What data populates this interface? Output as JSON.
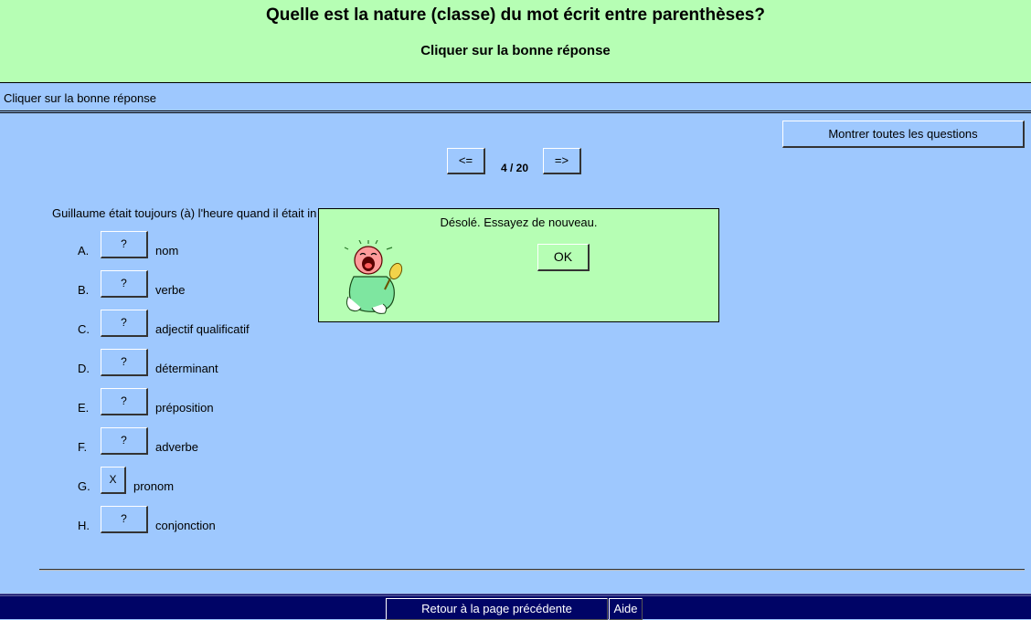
{
  "header": {
    "title": "Quelle est la nature (classe) du mot écrit entre parenthèses?",
    "subtitle": "Cliquer sur la bonne réponse"
  },
  "instruction": "Cliquer sur la bonne réponse",
  "show_all_label": "Montrer toutes les questions",
  "nav": {
    "prev_label": "<=",
    "next_label": "=>",
    "counter": "4 / 20"
  },
  "question": "Guillaume était toujours (à) l'heure quand il était in",
  "options": [
    {
      "letter": "A.",
      "button": "?",
      "text": "nom"
    },
    {
      "letter": "B.",
      "button": "?",
      "text": "verbe"
    },
    {
      "letter": "C.",
      "button": "?",
      "text": "adjectif qualificatif"
    },
    {
      "letter": "D.",
      "button": "?",
      "text": "déterminant"
    },
    {
      "letter": "E.",
      "button": "?",
      "text": "préposition"
    },
    {
      "letter": "F.",
      "button": "?",
      "text": "adverbe"
    },
    {
      "letter": "G.",
      "button": "X",
      "text": "pronom"
    },
    {
      "letter": "H.",
      "button": "?",
      "text": "conjonction"
    }
  ],
  "footer": {
    "back_label": "Retour à la page précédente",
    "help_label": "Aide"
  },
  "dialog": {
    "message": "Désolé. Essayez de nouveau.",
    "ok_label": "OK",
    "image_icon": "crying-baby-icon"
  },
  "colors": {
    "background": "#9ec8fe",
    "header": "#b6feb4",
    "footer": "#000466"
  }
}
